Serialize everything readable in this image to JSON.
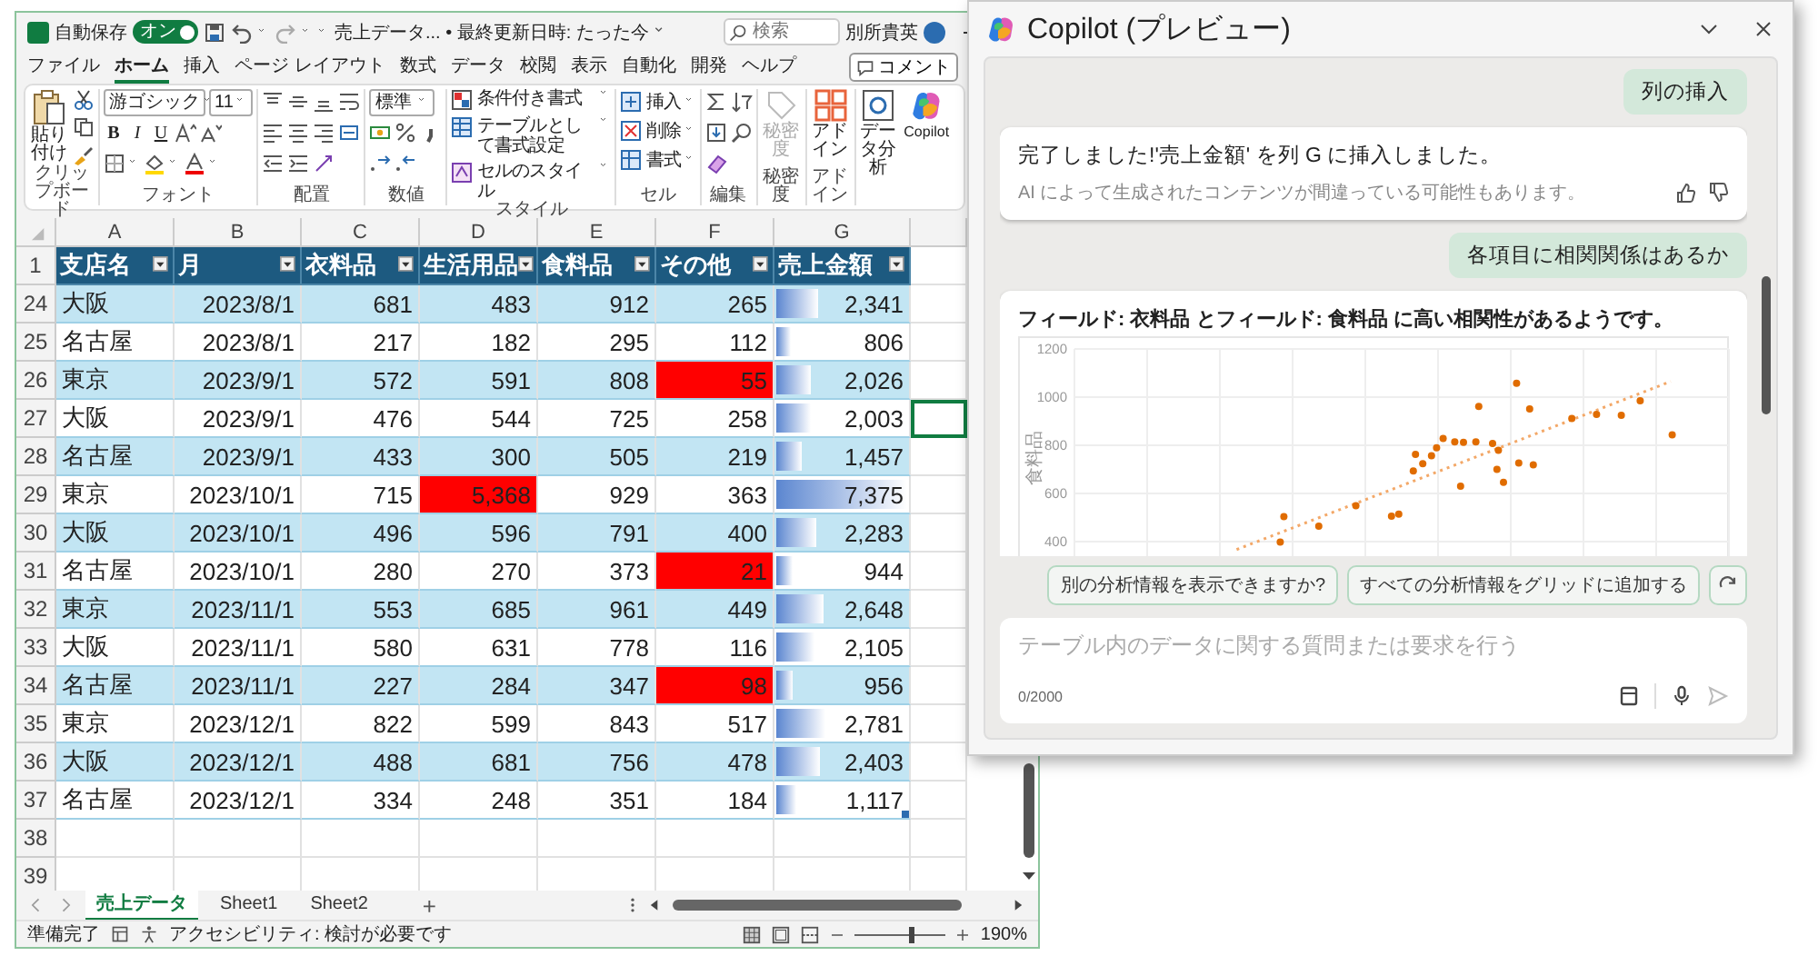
{
  "title_bar": {
    "autosave_label": "自動保存",
    "autosave_on": true,
    "toggle_text": "オン",
    "document_title": "売上データ... • 最終更新日時: たった今",
    "search_placeholder": "検索",
    "user_name": "別所貴英"
  },
  "menu": [
    {
      "label": "ファイル",
      "selected": false
    },
    {
      "label": "ホーム",
      "selected": true
    },
    {
      "label": "挿入",
      "selected": false
    },
    {
      "label": "ページ レイアウト",
      "selected": false
    },
    {
      "label": "数式",
      "selected": false
    },
    {
      "label": "データ",
      "selected": false
    },
    {
      "label": "校閲",
      "selected": false
    },
    {
      "label": "表示",
      "selected": false
    },
    {
      "label": "自動化",
      "selected": false
    },
    {
      "label": "開発",
      "selected": false
    },
    {
      "label": "ヘルプ",
      "selected": false
    }
  ],
  "comment_button": "コメント",
  "ribbon": [
    {
      "kind": "clipboard",
      "label": "クリップボード",
      "items": [
        "貼り付け"
      ]
    },
    {
      "kind": "font",
      "label": "フォント",
      "items": [
        "游ゴシック",
        "11"
      ],
      "format_buttons": [
        "B",
        "I",
        "U"
      ]
    },
    {
      "kind": "alignment",
      "label": "配置"
    },
    {
      "kind": "number",
      "label": "数値",
      "items": [
        "標準"
      ]
    },
    {
      "kind": "styles",
      "label": "スタイル",
      "items": [
        "条件付き書式",
        "テーブルとして書式設定",
        "セルのスタイル"
      ]
    },
    {
      "kind": "cells",
      "label": "セル",
      "items": [
        "挿入",
        "削除",
        "書式"
      ]
    },
    {
      "kind": "editing",
      "label": "編集"
    },
    {
      "kind": "sensitivity",
      "label": "秘密度",
      "items": [
        {
          "label": "秘密度",
          "disabled": true
        }
      ]
    },
    {
      "kind": "addins",
      "label": "アドイン",
      "items": [
        "アドイン"
      ]
    },
    {
      "kind": "tools",
      "items": [
        "データ分析",
        "Copilot"
      ]
    }
  ],
  "sheet": {
    "columns": [
      "A",
      "B",
      "C",
      "D",
      "E",
      "F",
      "G"
    ],
    "header_row": {
      "number": "1",
      "cells": [
        "支店名",
        "月",
        "衣料品",
        "生活用品",
        "食料品",
        "その他",
        "売上金額"
      ]
    },
    "rows": [
      {
        "number": "24",
        "selected": false,
        "level": 0.32,
        "cells": [
          "大阪",
          "2023/8/1",
          "681",
          "483",
          "912",
          "265",
          "2,341"
        ],
        "flagged": [
          false,
          false,
          false,
          false,
          false,
          false,
          false
        ]
      },
      {
        "number": "25",
        "selected": false,
        "level": 0.11,
        "cells": [
          "名古屋",
          "2023/8/1",
          "217",
          "182",
          "295",
          "112",
          "806"
        ],
        "flagged": [
          false,
          false,
          false,
          false,
          false,
          false,
          false
        ]
      },
      {
        "number": "26",
        "selected": false,
        "level": 0.27,
        "cells": [
          "東京",
          "2023/9/1",
          "572",
          "591",
          "808",
          "55",
          "2,026"
        ],
        "flagged": [
          false,
          false,
          false,
          false,
          false,
          true,
          false
        ]
      },
      {
        "number": "27",
        "selected": true,
        "level": 0.27,
        "cells": [
          "大阪",
          "2023/9/1",
          "476",
          "544",
          "725",
          "258",
          "2,003"
        ],
        "flagged": [
          false,
          false,
          false,
          false,
          false,
          false,
          false
        ]
      },
      {
        "number": "28",
        "selected": false,
        "level": 0.2,
        "cells": [
          "名古屋",
          "2023/9/1",
          "433",
          "300",
          "505",
          "219",
          "1,457"
        ],
        "flagged": [
          false,
          false,
          false,
          false,
          false,
          false,
          false
        ]
      },
      {
        "number": "29",
        "selected": false,
        "level": 1,
        "cells": [
          "東京",
          "2023/10/1",
          "715",
          "5,368",
          "929",
          "363",
          "7,375"
        ],
        "flagged": [
          false,
          false,
          false,
          true,
          false,
          false,
          false
        ]
      },
      {
        "number": "30",
        "selected": false,
        "level": 0.31,
        "cells": [
          "大阪",
          "2023/10/1",
          "496",
          "596",
          "791",
          "400",
          "2,283"
        ],
        "flagged": [
          false,
          false,
          false,
          false,
          false,
          false,
          false
        ]
      },
      {
        "number": "31",
        "selected": false,
        "level": 0.13,
        "cells": [
          "名古屋",
          "2023/10/1",
          "280",
          "270",
          "373",
          "21",
          "944"
        ],
        "flagged": [
          false,
          false,
          false,
          false,
          false,
          true,
          false
        ]
      },
      {
        "number": "32",
        "selected": false,
        "level": 0.36,
        "cells": [
          "東京",
          "2023/11/1",
          "553",
          "685",
          "961",
          "449",
          "2,648"
        ],
        "flagged": [
          false,
          false,
          false,
          false,
          false,
          false,
          false
        ]
      },
      {
        "number": "33",
        "selected": false,
        "level": 0.29,
        "cells": [
          "大阪",
          "2023/11/1",
          "580",
          "631",
          "778",
          "116",
          "2,105"
        ],
        "flagged": [
          false,
          false,
          false,
          false,
          false,
          false,
          false
        ]
      },
      {
        "number": "34",
        "selected": false,
        "level": 0.13,
        "cells": [
          "名古屋",
          "2023/11/1",
          "227",
          "284",
          "347",
          "98",
          "956"
        ],
        "flagged": [
          false,
          false,
          false,
          false,
          false,
          true,
          false
        ]
      },
      {
        "number": "35",
        "selected": false,
        "level": 0.38,
        "cells": [
          "東京",
          "2023/12/1",
          "822",
          "599",
          "843",
          "517",
          "2,781"
        ],
        "flagged": [
          false,
          false,
          false,
          false,
          false,
          false,
          false
        ]
      },
      {
        "number": "36",
        "selected": false,
        "level": 0.33,
        "cells": [
          "大阪",
          "2023/12/1",
          "488",
          "681",
          "756",
          "478",
          "2,403"
        ],
        "flagged": [
          false,
          false,
          false,
          false,
          false,
          false,
          false
        ]
      },
      {
        "number": "37",
        "selected": false,
        "level": 0.15,
        "cells": [
          "名古屋",
          "2023/12/1",
          "334",
          "248",
          "351",
          "184",
          "1,117"
        ],
        "flagged": [
          false,
          false,
          false,
          false,
          false,
          false,
          false
        ]
      }
    ],
    "empty_rows": [
      "38",
      "39"
    ]
  },
  "sheet_tabs": [
    {
      "label": "売上データ",
      "selected": true
    },
    {
      "label": "Sheet1",
      "selected": false
    },
    {
      "label": "Sheet2",
      "selected": false
    }
  ],
  "add_sheet": "+",
  "status_bar": {
    "ready": "準備完了",
    "accessibility": "アクセシビリティ: 検討が必要です",
    "zoom": "190%",
    "zoom_slider": {
      "level": 0.62
    }
  },
  "copilot": {
    "title": "Copilot (プレビュー)",
    "messages": [
      {
        "kind": "user",
        "text": "列の挿入"
      },
      {
        "kind": "assistant",
        "text": "完了しました!'売上金額' を列 G に挿入しました。",
        "note": "AI によって生成されたコンテンツが間違っている可能性もあります。"
      },
      {
        "kind": "user",
        "text": "各項目に相関関係はあるか"
      },
      {
        "kind": "insight",
        "text": "フィールド: **衣料品** とフィールド: **食料品** に高い相関性があるようです。",
        "chart": {
          "ylabel": "食料品",
          "ytick_labels": [
            "1200",
            "1000",
            "800",
            "600",
            "400"
          ]
        }
      }
    ],
    "suggestions": [
      "別の分析情報を表示できますか?",
      "すべての分析情報をグリッドに追加する"
    ],
    "input": {
      "placeholder": "テーブル内のデータに関する質問または要求を行う",
      "counter": "0/2000"
    }
  }
}
